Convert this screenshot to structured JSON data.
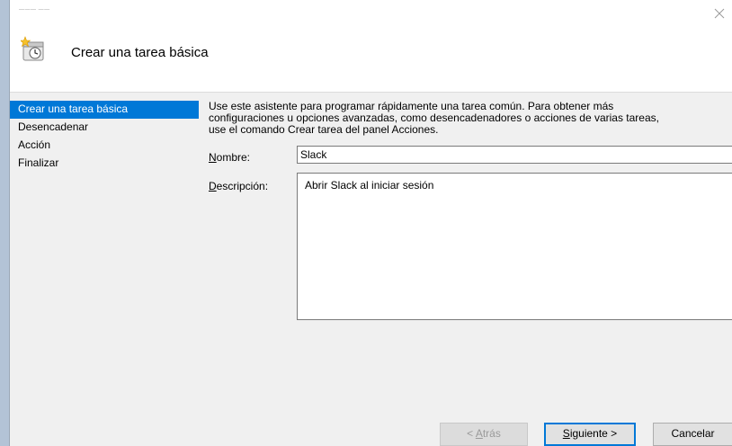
{
  "window": {
    "titlebar_text": "——— ——"
  },
  "header": {
    "title": "Crear una tarea básica",
    "icon": "scheduled-task-icon"
  },
  "sidebar": {
    "items": [
      {
        "label": "Crear una tarea básica",
        "active": true
      },
      {
        "label": "Desencadenar",
        "active": false
      },
      {
        "label": "Acción",
        "active": false
      },
      {
        "label": "Finalizar",
        "active": false
      }
    ]
  },
  "main": {
    "intro_line1": "Use este asistente para programar rápidamente una tarea común. Para obtener más",
    "intro_line2": "configuraciones u opciones avanzadas, como desencadenadores o acciones de varias tareas,",
    "intro_line3": "use el comando Crear tarea del panel Acciones.",
    "name_label_first": "N",
    "name_label_rest": "ombre:",
    "name_value": "Slack",
    "desc_label_first": "D",
    "desc_label_rest": "escripción:",
    "desc_value": "Abrir Slack al iniciar sesión"
  },
  "footer": {
    "back_prefix": "< ",
    "back_first": "A",
    "back_rest": "trás",
    "next_first": "S",
    "next_rest": "iguiente >",
    "cancel_label": "Cancelar"
  },
  "colors": {
    "accent": "#0078d7",
    "background": "#f0f0f0"
  }
}
